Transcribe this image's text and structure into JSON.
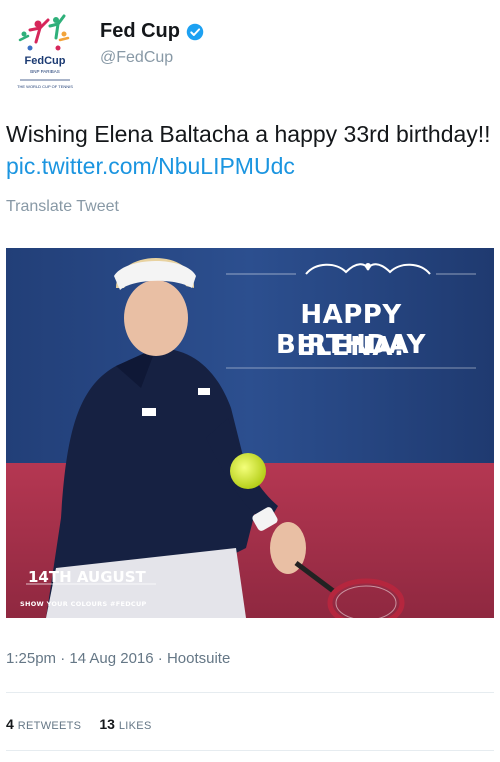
{
  "author": {
    "name": "Fed Cup",
    "handle": "@FedCup",
    "logo_text": "FedCup",
    "logo_subtext": "BNP PARIBAS",
    "logo_tagline": "THE WORLD CUP OF TENNIS",
    "verified": true,
    "verified_icon": "verified-badge-icon",
    "verified_color": "#1da1f2"
  },
  "tweet": {
    "text": "Wishing Elena Baltacha a happy 33rd birthday!! ",
    "link": "pic.twitter.com/NbuLIPMUdc",
    "link_color": "#1b95e0",
    "translate_label": "Translate Tweet"
  },
  "media": {
    "headline_line1": "HAPPY BIRTHDAY",
    "headline_line2": "ELENA!",
    "date_label": "14TH AUGUST",
    "tagline": "SHOW YOUR COLOURS #FEDCUP",
    "bg_blue": "#2a4a86",
    "bg_red": "#b83a55"
  },
  "meta": {
    "timestamp": "1:25pm · 14 Aug 2016 · Hootsuite"
  },
  "stats": {
    "retweets_count": "4",
    "retweets_label": "RETWEETS",
    "likes_count": "13",
    "likes_label": "LIKES"
  }
}
